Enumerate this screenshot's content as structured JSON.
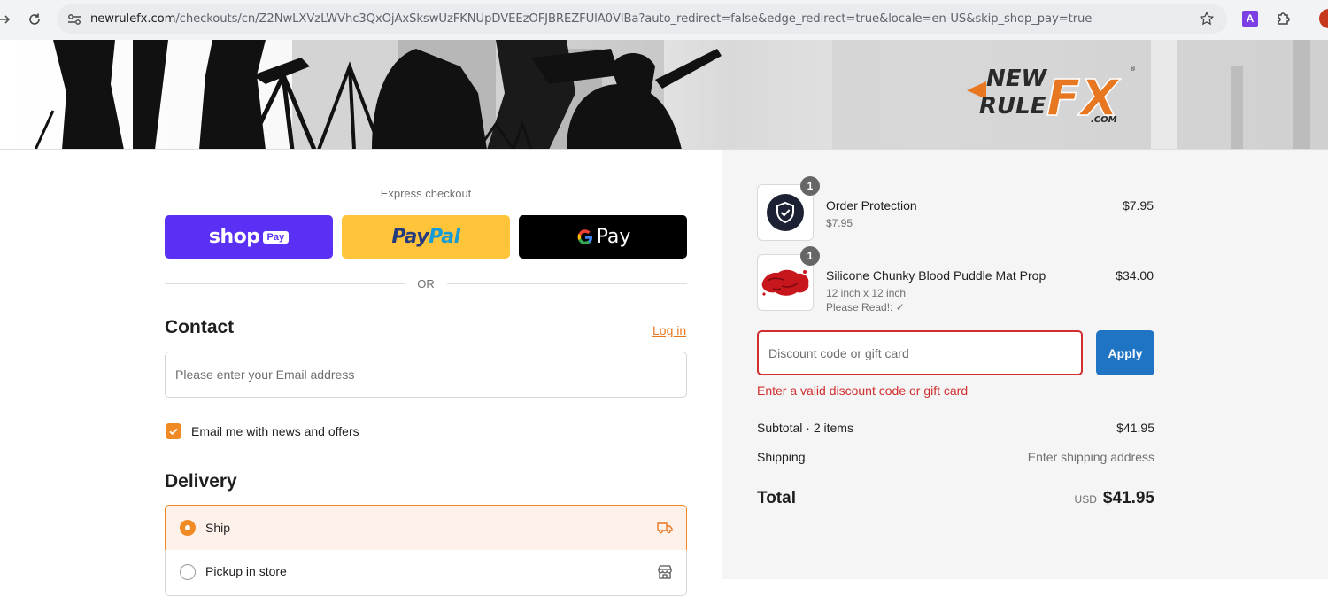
{
  "browser": {
    "url_host": "newrulefx.com",
    "url_path": "/checkouts/cn/Z2NwLXVzLWVhc3QxOjAxSkswUzFKNUpDVEEzOFJBREZFUlA0VlBa?auto_redirect=false&edge_redirect=true&locale=en-US&skip_shop_pay=true",
    "extension_letter": "A"
  },
  "banner": {
    "logo_line1": "NEW",
    "logo_line2": "RULE",
    "logo_fx": "FX",
    "logo_dotcom": ".COM"
  },
  "express": {
    "label": "Express checkout",
    "shop_word": "shop",
    "shop_pay": "Pay",
    "paypal_1": "Pay",
    "paypal_2": "Pal",
    "gpay_g": "G",
    "gpay_word": "Pay",
    "or": "OR"
  },
  "contact": {
    "title": "Contact",
    "login": "Log in",
    "email_placeholder": "Please enter your Email address",
    "newsletter_label": "Email me with news and offers",
    "newsletter_checked": true
  },
  "delivery": {
    "title": "Delivery",
    "options": [
      {
        "label": "Ship",
        "selected": true,
        "icon": "truck-icon"
      },
      {
        "label": "Pickup in store",
        "selected": false,
        "icon": "store-icon"
      }
    ]
  },
  "summary": {
    "items": [
      {
        "name": "Order Protection",
        "sub1": "$7.95",
        "sub2": "",
        "price": "$7.95",
        "qty": "1",
        "icon": "shield-check-icon"
      },
      {
        "name": "Silicone Chunky Blood Puddle Mat Prop",
        "sub1": "12 inch x 12 inch",
        "sub2": "Please Read!: ✓",
        "price": "$34.00",
        "qty": "1",
        "icon": "blood-puddle-image"
      }
    ],
    "discount_placeholder": "Discount code or gift card",
    "apply_label": "Apply",
    "error": "Enter a valid discount code or gift card",
    "subtotal_label": "Subtotal · 2 items",
    "subtotal_value": "$41.95",
    "shipping_label": "Shipping",
    "shipping_value": "Enter shipping address",
    "total_label": "Total",
    "currency": "USD",
    "total_value": "$41.95"
  },
  "colors": {
    "accent": "#f08a24",
    "error": "#d12f2f",
    "apply": "#1f74c4",
    "shop_pay": "#5a31f4",
    "paypal": "#ffc439"
  }
}
